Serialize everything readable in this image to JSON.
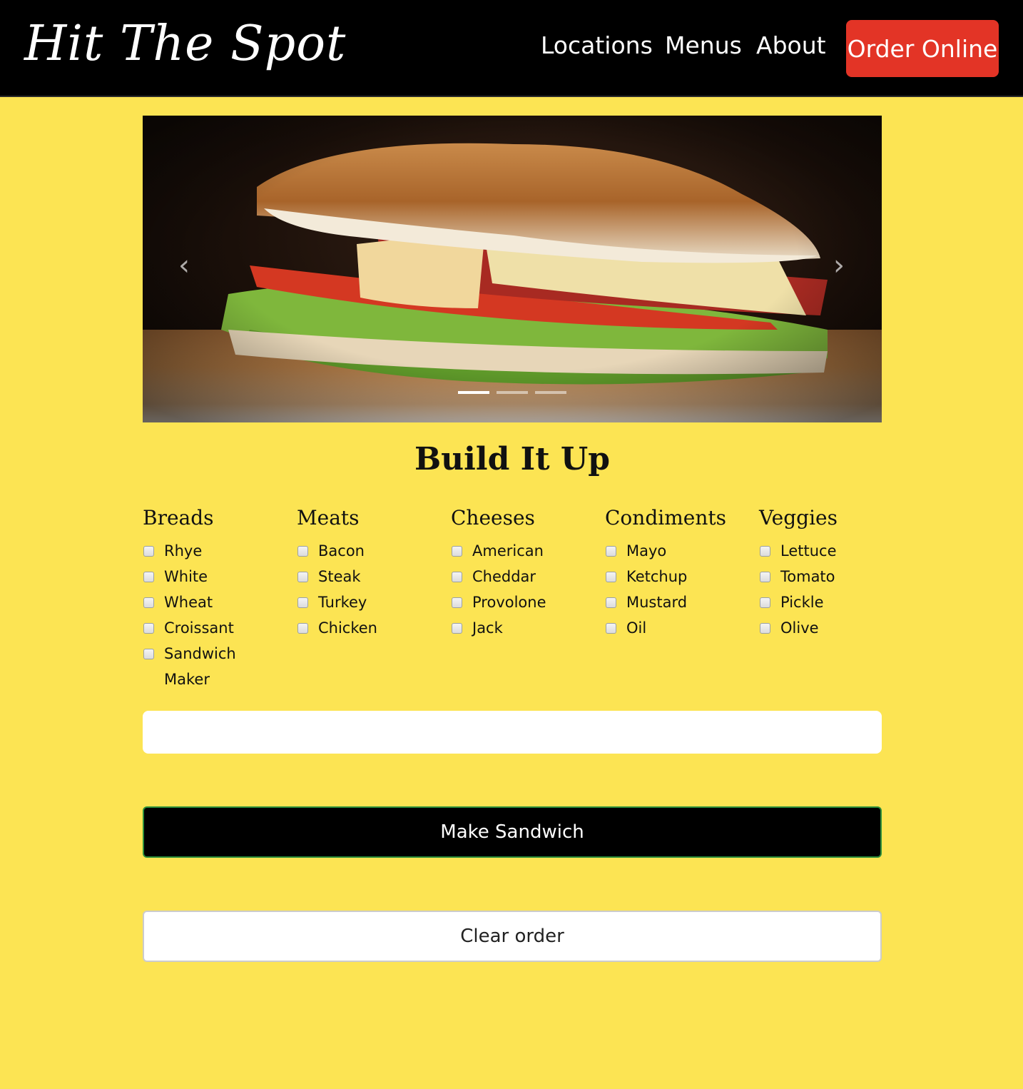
{
  "header": {
    "brand": "Hit The Spot",
    "nav": {
      "locations": "Locations",
      "menus": "Menus",
      "about": "About"
    },
    "order_online": "Order Online"
  },
  "carousel": {
    "prev_icon": "chevron-left-icon",
    "next_icon": "chevron-right-icon",
    "prev_glyph": "‹",
    "next_glyph": "›",
    "slides": 3,
    "active_slide": 1
  },
  "builder": {
    "title": "Build It Up",
    "breads": {
      "heading": "Breads",
      "options": [
        "Rhye",
        "White",
        "Wheat",
        "Croissant",
        "Sandwich Maker"
      ]
    },
    "meats": {
      "heading": "Meats",
      "options": [
        "Bacon",
        "Steak",
        "Turkey",
        "Chicken"
      ]
    },
    "cheeses": {
      "heading": "Cheeses",
      "options": [
        "American",
        "Cheddar",
        "Provolone",
        "Jack"
      ]
    },
    "condiments": {
      "heading": "Condiments",
      "options": [
        "Mayo",
        "Ketchup",
        "Mustard",
        "Oil"
      ]
    },
    "veggies": {
      "heading": "Veggies",
      "options": [
        "Lettuce",
        "Tomato",
        "Pickle",
        "Olive"
      ]
    }
  },
  "order_field": {
    "value": ""
  },
  "actions": {
    "make": "Make Sandwich",
    "clear": "Clear order"
  },
  "colors": {
    "page_bg": "#fce453",
    "header_bg": "#000000",
    "order_online_bg": "#e33426",
    "make_button_border": "#2c8f3a"
  }
}
